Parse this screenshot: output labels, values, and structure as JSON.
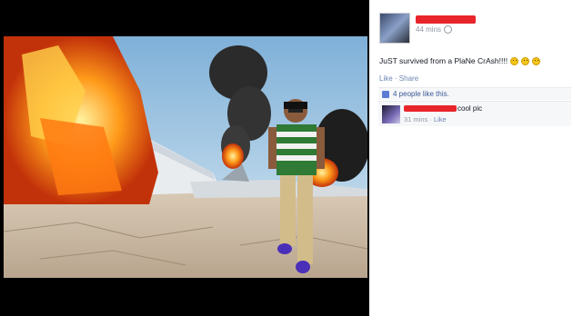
{
  "post": {
    "time": "44 mins",
    "caption": "JuST survived from a PlaNe CrAsh!!!!",
    "actions": {
      "like": "Like",
      "sep": " · ",
      "share": "Share"
    },
    "likes_text": "4 people like this."
  },
  "comment": {
    "text": "cool pic",
    "time": "31 mins",
    "sep": " · ",
    "like": "Like"
  },
  "colors": {
    "redaction": "#e8252a",
    "link": "#6d84b4",
    "meta": "#9197a3"
  },
  "icons": [
    "globe-icon",
    "smile-emoji-icon",
    "thumbs-up-icon"
  ]
}
